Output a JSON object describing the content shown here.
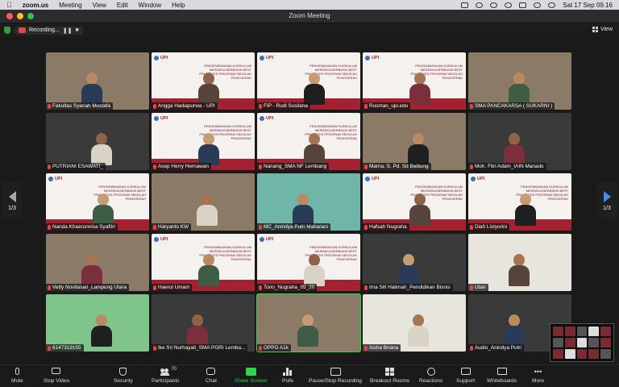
{
  "menubar": {
    "apple_icon": "apple-logo-icon",
    "app": "zoom.us",
    "items": [
      "Meeting",
      "View",
      "Edit",
      "Window",
      "Help"
    ],
    "clock": "Sat 17 Sep  09.16"
  },
  "window": {
    "title": "Zoom Meeting"
  },
  "status": {
    "recording_label": "Recording...",
    "view_label": "View"
  },
  "pager": {
    "page_left": "1/3",
    "page_right": "1/3"
  },
  "participants": [
    {
      "name": "Fakultas Syariah Mustafa",
      "scene": "room"
    },
    {
      "name": "Angga Hadiapurwa - UPI",
      "scene": "slide"
    },
    {
      "name": "FIP - Rudi Susilana",
      "scene": "slide"
    },
    {
      "name": "Rusman_upi.edu",
      "scene": "slide"
    },
    {
      "name": "SMA PANCAKARSA ( SUKARNI )",
      "scene": "room"
    },
    {
      "name": "PUTRIANI ESAWATI_",
      "scene": "dark"
    },
    {
      "name": "Asep Herry Hernawan",
      "scene": "slide"
    },
    {
      "name": "Nanang_SMA NF Lembang",
      "scene": "slide"
    },
    {
      "name": "Marna. S. Pd. Sd Belitung",
      "scene": "room"
    },
    {
      "name": "Moh. Fitri Adam_IAIN Manado",
      "scene": "dark"
    },
    {
      "name": "Nanda Khaerunnisa Syafitri",
      "scene": "slide"
    },
    {
      "name": "Haryanto KW",
      "scene": "room"
    },
    {
      "name": "MC_Anindya Putri Maharani",
      "scene": "teal"
    },
    {
      "name": "Hafsah Nugraha",
      "scene": "slide"
    },
    {
      "name": "Diah Listyorini",
      "scene": "slide"
    },
    {
      "name": "Vetty Novitasari_Lampung Utara",
      "scene": "room"
    },
    {
      "name": "Haerul Umam",
      "scene": "slide"
    },
    {
      "name": "Tono_Nugraha_05_20",
      "scene": "slide"
    },
    {
      "name": "Ima Siti Halimah_Pendidikan Bisnis",
      "scene": "dark"
    },
    {
      "name": "Utari",
      "scene": "light"
    },
    {
      "name": "6147319155",
      "scene": "green"
    },
    {
      "name": "Ike Sri Nurhayati_SMA PGRI Lemba...",
      "scene": "dark"
    },
    {
      "name": "OPPO A1k",
      "scene": "room"
    },
    {
      "name": "Aisha Briana",
      "scene": "light"
    },
    {
      "name": "Audio_Anindya Putri",
      "scene": "dark"
    }
  ],
  "slide": {
    "logo": "UPI",
    "heading": "PENGEMBANGAN KURIKULUM MERDEKA BERBASIS BEST PRACTICES PROGRAM SEKOLAH PENGGERAK"
  },
  "toolbar": {
    "mute": "Mute",
    "stop_video": "Stop Video",
    "security": "Security",
    "participants": "Participants",
    "participants_count": "70",
    "chat": "Chat",
    "share_screen": "Share Screen",
    "polls": "Polls",
    "record": "Pause/Stop Recording",
    "breakout": "Breakout Rooms",
    "reactions": "Reactions",
    "support": "Support",
    "whiteboards": "Whiteboards",
    "more": "More"
  },
  "colors": {
    "accent_green": "#2fd54b",
    "record_red": "#e84545",
    "slide_red": "#a4212f",
    "pager_blue": "#3e8ef7"
  }
}
